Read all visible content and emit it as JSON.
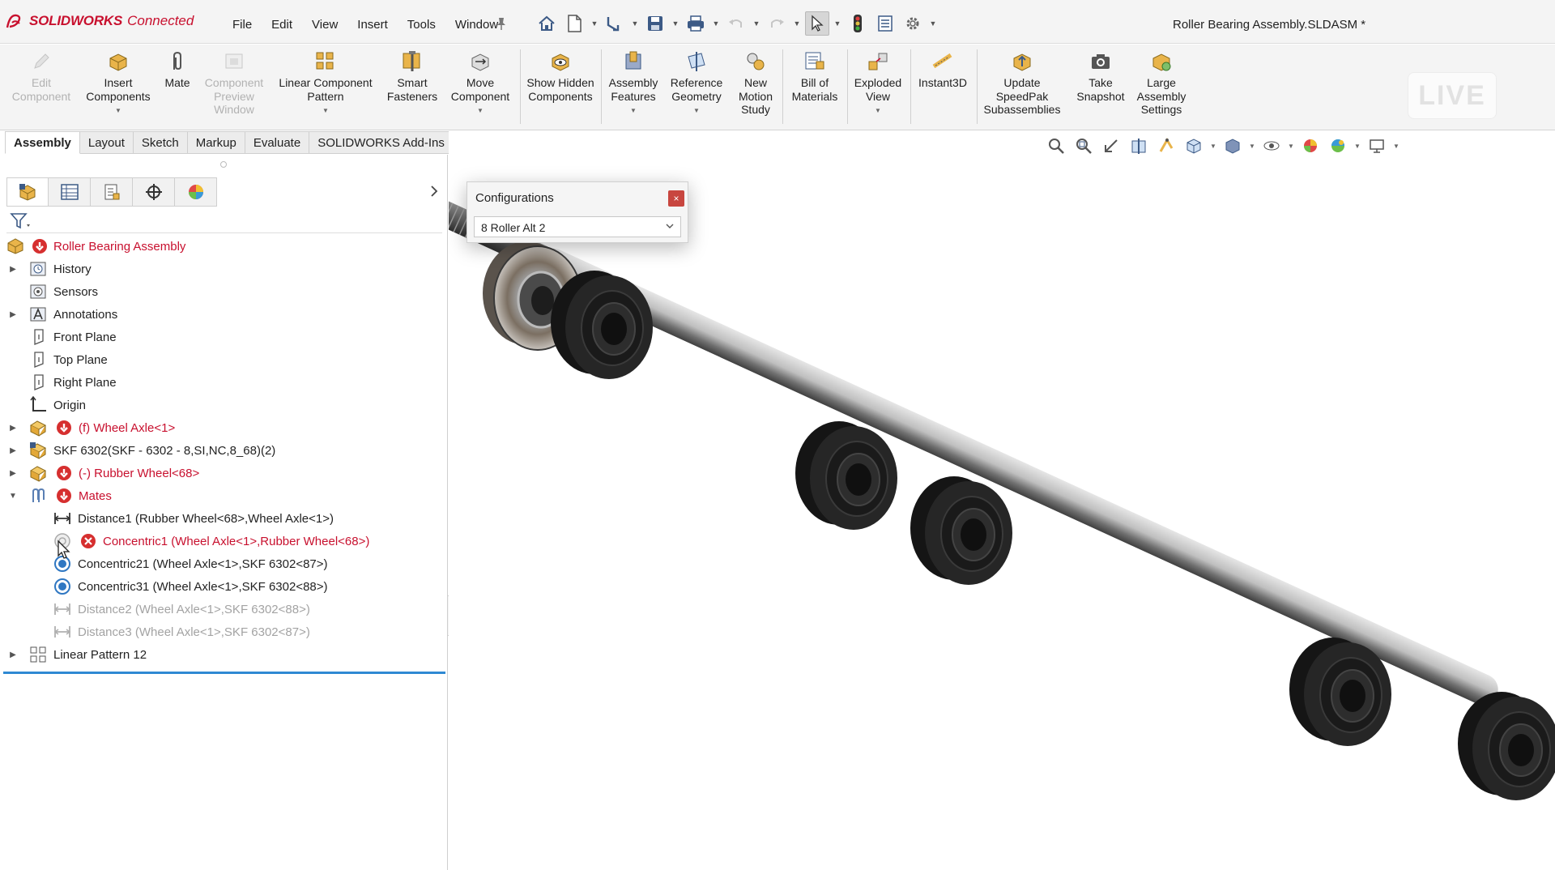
{
  "app": {
    "brand_bold": "SOLIDWORKS",
    "brand_light": "Connected",
    "document_title": "Roller Bearing Assembly.SLDASM *"
  },
  "menu": [
    "File",
    "Edit",
    "View",
    "Insert",
    "Tools",
    "Window"
  ],
  "commands": {
    "edit_component": "Edit Component",
    "insert_components": "Insert Components",
    "mate": "Mate",
    "component_preview": "Component Preview Window",
    "linear_pattern": "Linear Component Pattern",
    "smart_fasteners": "Smart Fasteners",
    "move_component": "Move Component",
    "show_hidden": "Show Hidden Components",
    "assembly_features": "Assembly Features",
    "reference_geometry": "Reference Geometry",
    "new_motion_study": "New Motion Study",
    "bill_of_materials": "Bill of Materials",
    "exploded_view": "Exploded View",
    "instant3d": "Instant3D",
    "update_speedpak": "Update SpeedPak Subassemblies",
    "take_snapshot": "Take Snapshot",
    "large_assembly": "Large Assembly Settings",
    "live_badge": "LIVE"
  },
  "tabs": [
    "Assembly",
    "Layout",
    "Sketch",
    "Markup",
    "Evaluate",
    "SOLIDWORKS Add-Ins"
  ],
  "configurations": {
    "title": "Configurations",
    "selected": "8 Roller Alt 2",
    "close_label": "×"
  },
  "tree": {
    "root": "Roller Bearing Assembly",
    "history": "History",
    "sensors": "Sensors",
    "annotations": "Annotations",
    "front_plane": "Front Plane",
    "top_plane": "Top Plane",
    "right_plane": "Right Plane",
    "origin": "Origin",
    "wheel_axle": "(f) Wheel Axle<1>",
    "skf": "SKF 6302(SKF - 6302 - 8,SI,NC,8_68)(2)",
    "rubber_wheel": "(-) Rubber Wheel<68>",
    "mates": "Mates",
    "distance1": "Distance1 (Rubber Wheel<68>,Wheel Axle<1>)",
    "concentric1": "Concentric1 (Wheel Axle<1>,Rubber Wheel<68>)",
    "concentric21": "Concentric21 (Wheel Axle<1>,SKF 6302<87>)",
    "concentric31": "Concentric31 (Wheel Axle<1>,SKF 6302<88>)",
    "distance2": "Distance2 (Wheel Axle<1>,SKF 6302<88>)",
    "distance3": "Distance3 (Wheel Axle<1>,SKF 6302<87>)",
    "linear_pattern": "Linear Pattern 12"
  },
  "colors": {
    "accent_red": "#c8102e",
    "tree_separator": "#2f89d3",
    "mate_blue": "#2f77c2"
  }
}
